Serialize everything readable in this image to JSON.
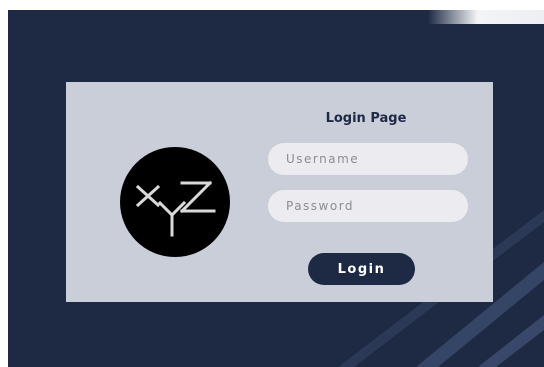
{
  "login": {
    "title": "Login Page",
    "logo_text": "XYZ",
    "username_placeholder": "Username",
    "password_placeholder": "Password",
    "login_label": "Login"
  },
  "colors": {
    "background": "#1e2a44",
    "card": "#c9ced8",
    "input": "#ececf0",
    "button": "#1e2a44",
    "logo": "#000000"
  }
}
